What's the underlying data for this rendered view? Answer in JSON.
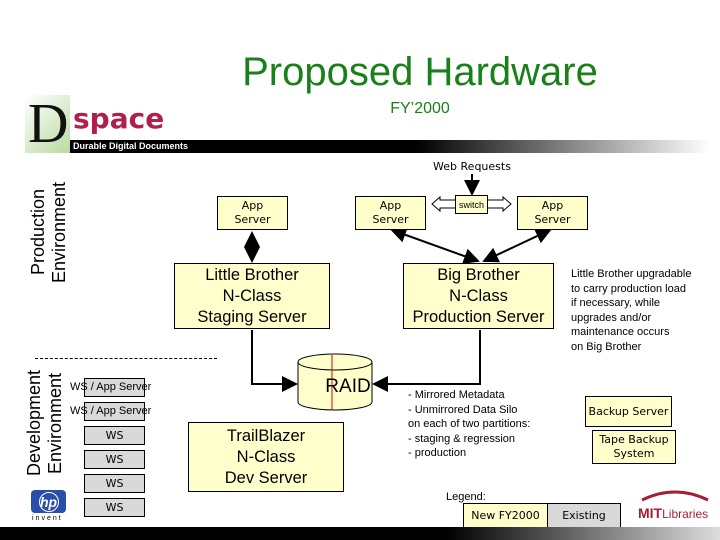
{
  "title": "Proposed Hardware",
  "subtitle": "FY’2000",
  "logo": {
    "letter": "D",
    "name": "space",
    "tagline": "Durable Digital Documents"
  },
  "sections": {
    "production": "Production Environment",
    "development": "Development Environment"
  },
  "web_requests": "Web Requests",
  "switch": "switch",
  "app_servers": [
    "App Server",
    "App Server",
    "App Server"
  ],
  "little_brother": [
    "Little Brother",
    "N-Class",
    "Staging Server"
  ],
  "big_brother": [
    "Big Brother",
    "N-Class",
    "Production Server"
  ],
  "note": "Little Brother upgradable\nto carry production load\nif necessary, while\nupgrades and/or\nmaintenance occurs\non Big Brother",
  "raid": "RAID",
  "raid_notes": "- Mirrored Metadata\n- Unmirrored Data Silo\non each of two partitions:\n- staging & regression\n- production",
  "workstations": [
    "WS / App Server",
    "WS / App Server",
    "WS",
    "WS",
    "WS",
    "WS"
  ],
  "trailblazer": [
    "TrailBlazer",
    "N-Class",
    "Dev Server"
  ],
  "backup_server": "Backup Server",
  "tape_backup": [
    "Tape Backup",
    "System"
  ],
  "legend": {
    "title": "Legend:",
    "new": "New FY2000",
    "existing": "Existing"
  },
  "hp_logo": {
    "mark": "hp",
    "tagline": "invent"
  },
  "mit_logo": {
    "bold": "MIT",
    "rest": "Libraries"
  },
  "colors": {
    "title": "#1a801a",
    "new": "#ffffcc",
    "existing": "#d9d9d9",
    "mit": "#a31f34"
  }
}
